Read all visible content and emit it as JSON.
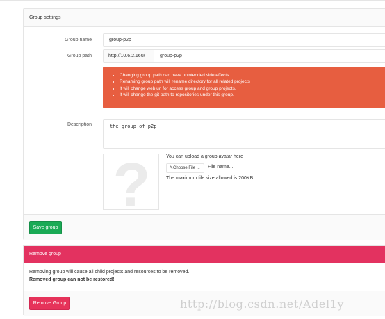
{
  "settings": {
    "heading": "Group settings",
    "group_name_label": "Group name",
    "group_name_value": "group-p2p",
    "group_path_label": "Group path",
    "group_path_prefix": "http://10.6.2.160/",
    "group_path_value": "group-p2p",
    "warnings": [
      "Changing group path can have unintended side effects.",
      "Renaming group path will rename directory for all related projects",
      "It will change web url for access group and group projects.",
      "It will change the git path to repositories under this group."
    ],
    "description_label": "Description",
    "description_value": "the group of p2p",
    "avatar_placeholder_glyph": "?",
    "avatar_hint": "You can upload a group avatar here",
    "choose_file_icon": "paperclip-icon",
    "choose_file_glyph": "✎",
    "choose_file_label": "Choose File ...",
    "file_name_label": "File name...",
    "max_size_note": "The maximum file size allowed is 200KB.",
    "save_button": "Save group"
  },
  "remove": {
    "heading": "Remove group",
    "message": "Removing group will cause all child projects and resources to be removed.",
    "message_strong": "Removed group can not be restored!",
    "button": "Remove Group"
  },
  "watermark": "http://blog.csdn.net/Adel1y",
  "colors": {
    "warning": "#e75e40",
    "save_green": "#1aaa55",
    "danger_header": "#e33260",
    "danger_button": "#e6335a"
  }
}
